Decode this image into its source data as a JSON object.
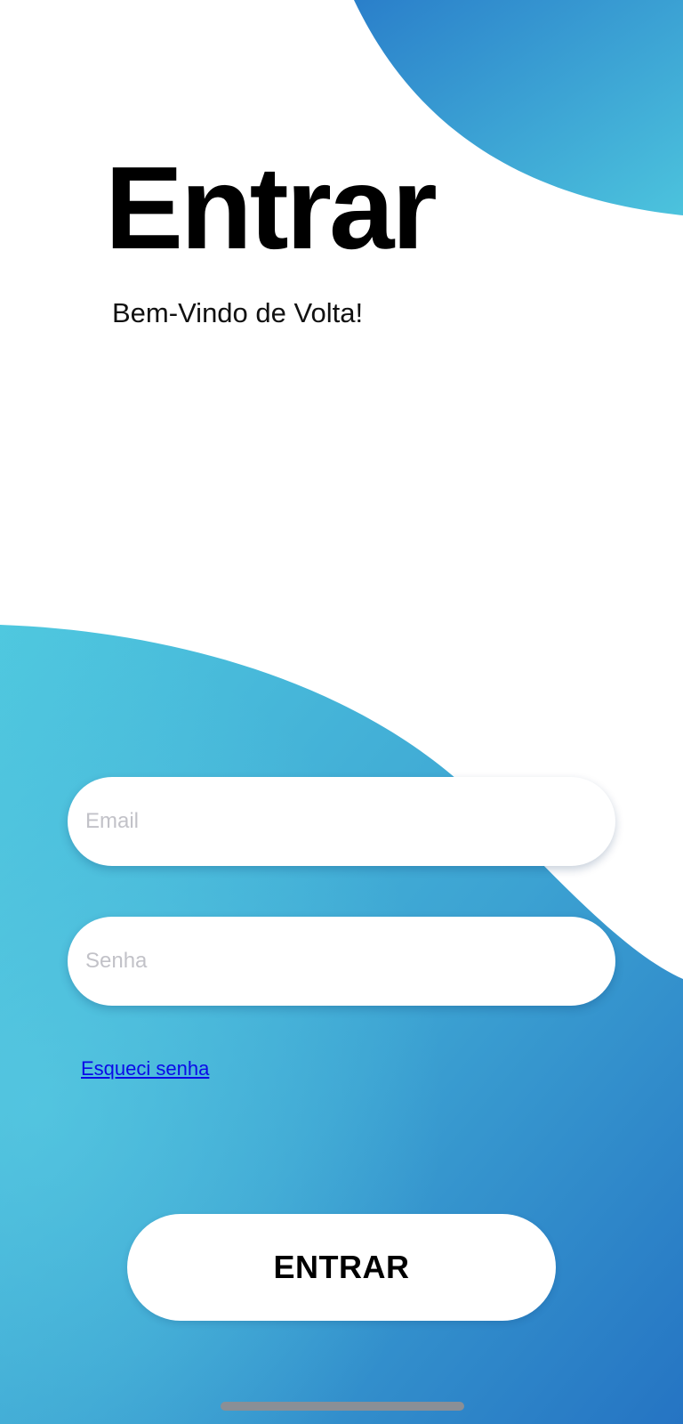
{
  "header": {
    "title": "Entrar",
    "subtitle": "Bem-Vindo de Volta!"
  },
  "form": {
    "email": {
      "value": "",
      "placeholder": "Email"
    },
    "password": {
      "value": "",
      "placeholder": "Senha"
    },
    "forgot_label": "Esqueci senha",
    "submit_label": "ENTRAR"
  },
  "colors": {
    "gradient_light": "#4fc6df",
    "gradient_dark": "#2575c4",
    "link": "#0a0ae8"
  }
}
